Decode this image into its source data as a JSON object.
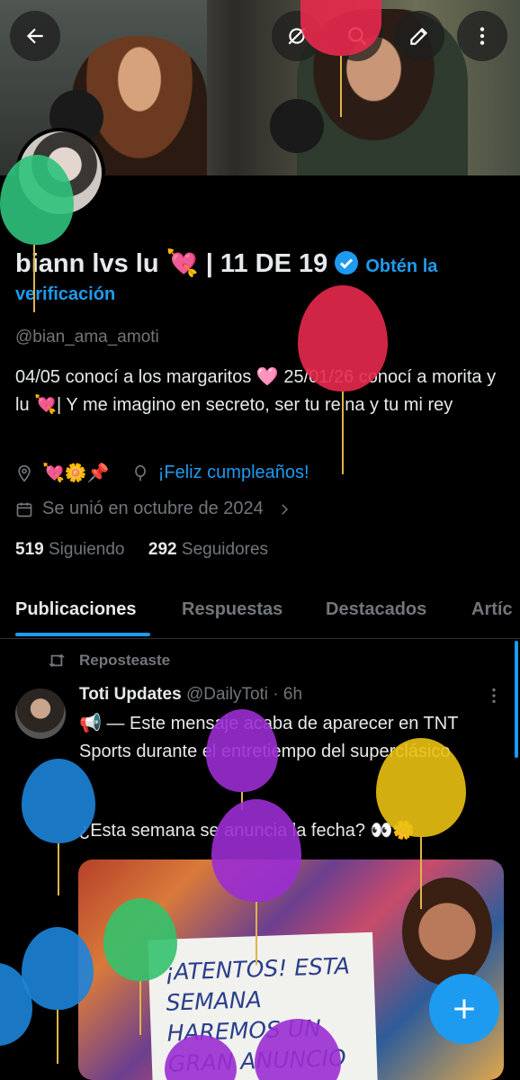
{
  "header": {
    "back_icon": "arrow-left-icon",
    "actions": [
      "no-signal-icon",
      "search-icon",
      "edit-icon",
      "more-vertical-icon"
    ]
  },
  "profile": {
    "name": "biann lvs lu 💘 | 11 DE 19",
    "verify_line1": "Obtén la",
    "verify_line2": "verificación",
    "handle": "@bian_ama_amoti",
    "bio": "04/05 conocí a los margaritos 🩷 25/01/26 conocí a morita y lu 💘| Y me imagino en secreto, ser tu reina y tu mi rey",
    "location": "💘🌼📌",
    "birthday": "¡Feliz cumpleaños!",
    "joined": "Se unió en octubre de 2024",
    "following_count": "519",
    "following_label": "Siguiendo",
    "followers_count": "292",
    "followers_label": "Seguidores"
  },
  "tabs": [
    "Publicaciones",
    "Respuestas",
    "Destacados",
    "Artíc"
  ],
  "tweet": {
    "repost_label": "Reposteaste",
    "author": "Toti Updates",
    "handle": "@DailyToti",
    "time": "· 6h",
    "body": "📢 — Este mensaje acaba de aparecer en TNT Sports durante el entretiempo del superclásico",
    "question": "¿Esta semana se anuncia la fecha? 👀🌼",
    "media_text": "¡ATENTOS! ESTA SEMANA HAREMOS UN GRAN ANUNCIO"
  },
  "fab_icon": "plus-icon",
  "colors": {
    "accent": "#1d9bf0",
    "background": "#000000",
    "muted": "#71767b"
  }
}
